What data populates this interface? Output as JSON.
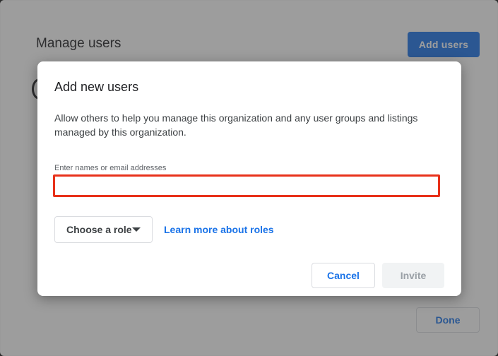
{
  "background_page": {
    "title": "Manage users",
    "add_users_label": "Add users",
    "done_label": "Done"
  },
  "dialog": {
    "title": "Add new users",
    "description": "Allow others to help you manage this organization and any user groups and listings managed by this organization.",
    "input": {
      "label": "Enter names or email addresses",
      "value": "",
      "placeholder": ""
    },
    "role_select": {
      "selected": "Choose a role",
      "icon": "caret-down-icon"
    },
    "learn_more_label": "Learn more about roles",
    "cancel_label": "Cancel",
    "invite_label": "Invite"
  },
  "colors": {
    "accent": "#1a73e8",
    "highlight_border": "#e8311a",
    "disabled_text": "#9aa0a6"
  }
}
